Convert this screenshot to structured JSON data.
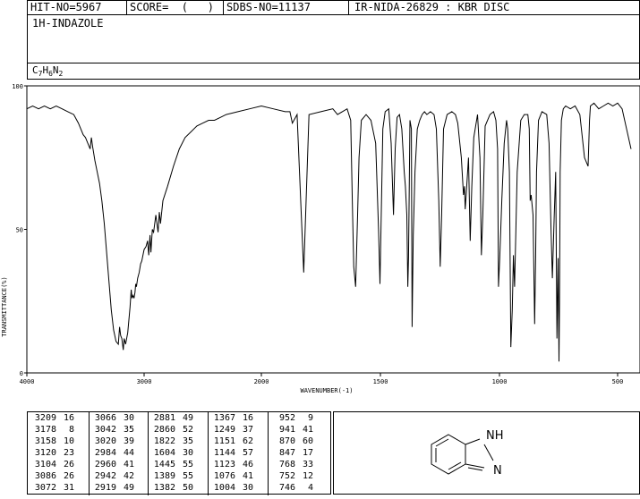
{
  "header": {
    "hit_no": "HIT-NO=5967",
    "score": "SCORE=  (   )",
    "sdbs_no": "SDBS-NO=11137",
    "method": "IR-NIDA-26829 : KBR DISC"
  },
  "compound": {
    "name": "1H-INDAZOLE",
    "formula_parts": [
      "C",
      "7",
      "H",
      "6",
      "N",
      "2"
    ]
  },
  "structure": {
    "nh_label": "NH",
    "h_label": "H",
    "n_label": "N"
  },
  "chart_data": {
    "type": "line",
    "xlabel": "WAVENUMBER(-1)",
    "ylabel": "TRANSMITTANCE(%)",
    "xlim": [
      4000,
      400
    ],
    "ylim": [
      0,
      100
    ],
    "x_ticks": [
      4000,
      3000,
      2000,
      1500,
      1000,
      500
    ],
    "y_ticks": [
      0,
      50,
      100
    ],
    "grid": false,
    "x": [
      4000,
      3950,
      3900,
      3850,
      3800,
      3750,
      3700,
      3650,
      3600,
      3560,
      3520,
      3500,
      3480,
      3460,
      3450,
      3440,
      3420,
      3400,
      3380,
      3360,
      3340,
      3320,
      3300,
      3280,
      3260,
      3240,
      3220,
      3209,
      3200,
      3190,
      3178,
      3170,
      3158,
      3140,
      3120,
      3110,
      3104,
      3095,
      3086,
      3078,
      3072,
      3066,
      3055,
      3042,
      3030,
      3020,
      3000,
      2984,
      2970,
      2960,
      2950,
      2942,
      2930,
      2919,
      2900,
      2881,
      2870,
      2860,
      2840,
      2800,
      2750,
      2700,
      2650,
      2600,
      2550,
      2500,
      2450,
      2400,
      2350,
      2300,
      2200,
      2100,
      2000,
      1950,
      1900,
      1880,
      1870,
      1850,
      1822,
      1800,
      1750,
      1700,
      1680,
      1660,
      1640,
      1625,
      1618,
      1612,
      1604,
      1596,
      1590,
      1580,
      1560,
      1540,
      1520,
      1508,
      1502,
      1496,
      1490,
      1480,
      1465,
      1455,
      1445,
      1438,
      1430,
      1420,
      1410,
      1400,
      1395,
      1389,
      1385,
      1382,
      1376,
      1370,
      1367,
      1362,
      1355,
      1345,
      1335,
      1325,
      1315,
      1305,
      1290,
      1275,
      1265,
      1255,
      1249,
      1243,
      1235,
      1220,
      1200,
      1185,
      1175,
      1160,
      1151,
      1147,
      1144,
      1140,
      1130,
      1123,
      1116,
      1108,
      1092,
      1082,
      1076,
      1070,
      1060,
      1040,
      1025,
      1015,
      1008,
      1004,
      999,
      990,
      980,
      970,
      965,
      958,
      952,
      946,
      941,
      936,
      925,
      910,
      895,
      880,
      874,
      870,
      866,
      858,
      851,
      847,
      843,
      835,
      820,
      800,
      790,
      782,
      776,
      768,
      762,
      757,
      752,
      748,
      746,
      743,
      738,
      730,
      720,
      700,
      680,
      660,
      640,
      625,
      619,
      615,
      600,
      580,
      560,
      540,
      520,
      500,
      480,
      460,
      440,
      420,
      400
    ],
    "y": [
      92,
      93,
      92,
      93,
      92,
      93,
      92,
      91,
      90,
      87,
      83,
      82,
      80,
      78,
      82,
      79,
      74,
      70,
      66,
      60,
      52,
      42,
      32,
      22,
      15,
      11,
      10,
      16,
      13,
      12,
      8,
      12,
      10,
      14,
      23,
      29,
      26,
      27,
      26,
      28,
      31,
      30,
      33,
      35,
      38,
      39,
      43,
      44,
      46,
      41,
      48,
      42,
      50,
      49,
      55,
      49,
      56,
      52,
      60,
      65,
      72,
      78,
      82,
      84,
      86,
      87,
      88,
      88,
      89,
      90,
      91,
      92,
      93,
      92,
      91,
      91,
      87,
      90,
      35,
      90,
      91,
      92,
      90,
      91,
      92,
      88,
      60,
      37,
      30,
      55,
      75,
      88,
      90,
      88,
      80,
      50,
      31,
      58,
      85,
      91,
      92,
      80,
      55,
      78,
      89,
      90,
      85,
      70,
      65,
      55,
      30,
      40,
      88,
      85,
      16,
      48,
      70,
      85,
      88,
      90,
      91,
      90,
      91,
      90,
      85,
      60,
      37,
      55,
      85,
      90,
      91,
      90,
      87,
      75,
      62,
      65,
      57,
      62,
      75,
      46,
      65,
      82,
      90,
      75,
      41,
      55,
      86,
      90,
      91,
      88,
      78,
      30,
      40,
      60,
      80,
      88,
      85,
      70,
      9,
      22,
      41,
      30,
      70,
      88,
      90,
      90,
      85,
      60,
      62,
      55,
      17,
      40,
      70,
      88,
      91,
      90,
      80,
      50,
      33,
      55,
      70,
      12,
      40,
      4,
      25,
      70,
      88,
      92,
      93,
      92,
      93,
      90,
      75,
      72,
      88,
      93,
      94,
      92,
      93,
      94,
      93,
      94,
      92,
      85,
      78
    ]
  },
  "peak_table": [
    [
      [
        3209,
        16
      ],
      [
        3178,
        8
      ],
      [
        3158,
        10
      ],
      [
        3120,
        23
      ],
      [
        3104,
        26
      ],
      [
        3086,
        26
      ],
      [
        3072,
        31
      ]
    ],
    [
      [
        3066,
        30
      ],
      [
        3042,
        35
      ],
      [
        3020,
        39
      ],
      [
        2984,
        44
      ],
      [
        2960,
        41
      ],
      [
        2942,
        42
      ],
      [
        2919,
        49
      ]
    ],
    [
      [
        2881,
        49
      ],
      [
        2860,
        52
      ],
      [
        1822,
        35
      ],
      [
        1604,
        30
      ],
      [
        1445,
        55
      ],
      [
        1389,
        55
      ],
      [
        1382,
        50
      ]
    ],
    [
      [
        1367,
        16
      ],
      [
        1249,
        37
      ],
      [
        1151,
        62
      ],
      [
        1144,
        57
      ],
      [
        1123,
        46
      ],
      [
        1076,
        41
      ],
      [
        1004,
        30
      ]
    ],
    [
      [
        952,
        9
      ],
      [
        941,
        41
      ],
      [
        870,
        60
      ],
      [
        847,
        17
      ],
      [
        768,
        33
      ],
      [
        752,
        12
      ],
      [
        746,
        4
      ]
    ]
  ]
}
